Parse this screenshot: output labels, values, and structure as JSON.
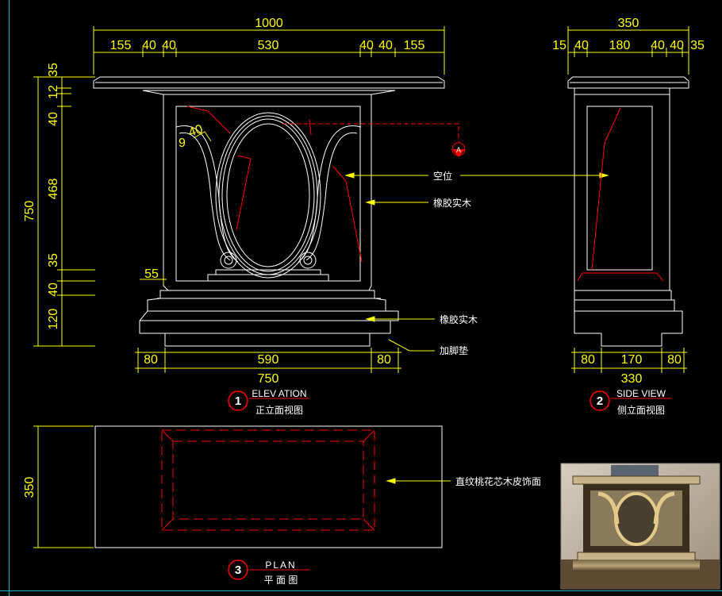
{
  "colors": {
    "background": "#000000",
    "outline": "#ffffff",
    "dimension": "#ffff00",
    "hidden": "#ff0000",
    "frame": "#1fb6c8"
  },
  "elevation": {
    "dims_top_total": "1000",
    "dims_top": [
      "155",
      "40",
      "40",
      "530",
      "40",
      "40",
      "155"
    ],
    "dims_left_total": "750",
    "dims_left": [
      "35",
      "12",
      "40",
      "468",
      "35",
      "40",
      "120"
    ],
    "dims_bottom": [
      "80",
      "590",
      "80"
    ],
    "dims_bottom_total": "750",
    "dim_55": "55",
    "arch_dims": [
      "9",
      "40"
    ],
    "section_marker": "A",
    "callouts": {
      "void": "空位",
      "rubberwood_1": "橡胶实木",
      "rubberwood_2": "橡胶实木",
      "foot_pad": "加脚垫"
    },
    "title": {
      "number": "1",
      "en": "ELEV ATION",
      "cn": "正立面视图"
    }
  },
  "side_view": {
    "dims_top_total": "350",
    "dims_top": [
      "15",
      "40",
      "180",
      "40",
      "40",
      "35"
    ],
    "dims_bottom": [
      "80",
      "170",
      "80"
    ],
    "dims_bottom_total": "330",
    "title": {
      "number": "2",
      "en": "SIDE VIEW",
      "cn": "侧立面视图"
    }
  },
  "plan": {
    "dim_left": "350",
    "callout": "直纹桃花芯木皮饰面",
    "title": {
      "number": "3",
      "en": "PLAN",
      "cn": "平 面 图"
    }
  },
  "photo": {
    "icon": "console-table-photo"
  }
}
